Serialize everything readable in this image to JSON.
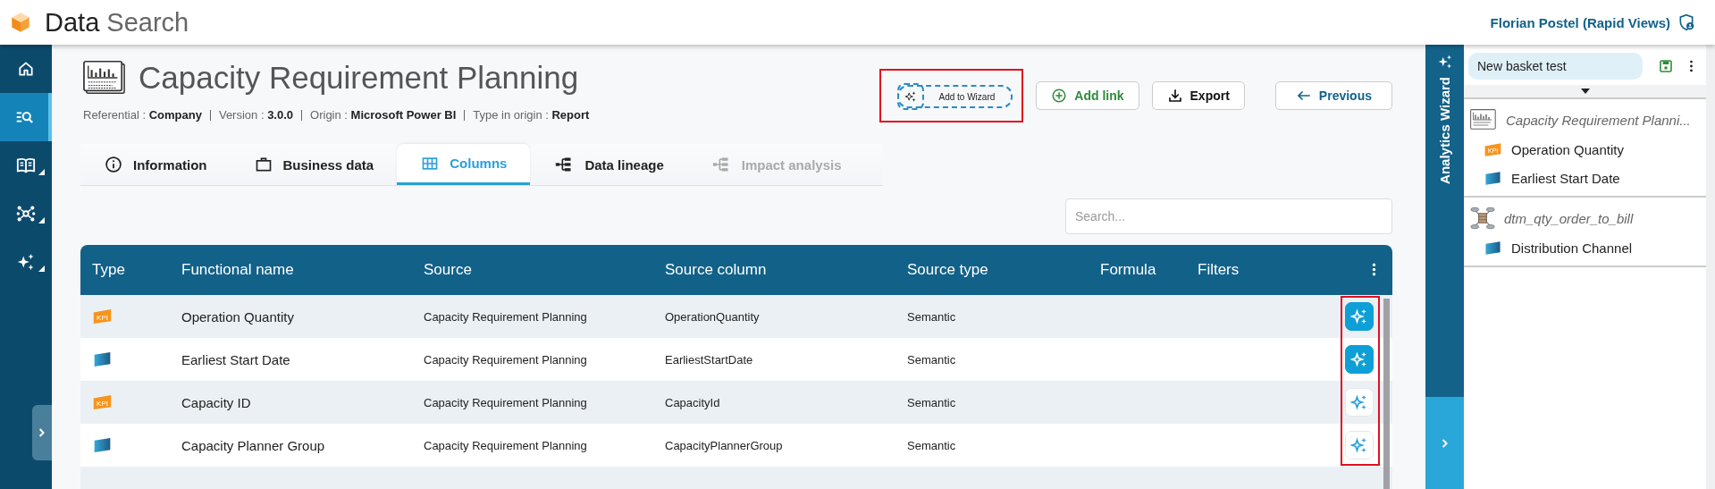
{
  "header": {
    "app_name_first": "Data",
    "app_name_second": "Search",
    "user": "Florian Postel (Rapid Views)"
  },
  "nav": {
    "items": [
      {
        "kind": "home",
        "selected": false,
        "submenu": false
      },
      {
        "kind": "search",
        "selected": true,
        "submenu": false
      },
      {
        "kind": "book",
        "selected": false,
        "submenu": true
      },
      {
        "kind": "network",
        "selected": false,
        "submenu": true
      },
      {
        "kind": "sparkle",
        "selected": false,
        "submenu": true
      }
    ]
  },
  "report": {
    "title": "Capacity Requirement Planning",
    "meta": [
      {
        "label": "Referential :",
        "value": "Company"
      },
      {
        "label": "Version :",
        "value": "3.0.0"
      },
      {
        "label": "Origin :",
        "value": "Microsoft Power BI"
      },
      {
        "label": "Type in origin :",
        "value": "Report"
      }
    ],
    "actions": [
      {
        "kind": "wizard",
        "label": "Add to Wizard",
        "highlighted": true
      },
      {
        "kind": "add",
        "label": "Add link",
        "highlighted": false
      },
      {
        "kind": "export",
        "label": "Export",
        "highlighted": false
      },
      {
        "kind": "previous",
        "label": "Previous",
        "highlighted": false
      }
    ]
  },
  "tabs": [
    {
      "kind": "info",
      "label": "Information",
      "selected": false,
      "disabled": false
    },
    {
      "kind": "briefcase",
      "label": "Business data",
      "selected": false,
      "disabled": false
    },
    {
      "kind": "grid",
      "label": "Columns",
      "selected": true,
      "disabled": false
    },
    {
      "kind": "lineage",
      "label": "Data lineage",
      "selected": false,
      "disabled": false
    },
    {
      "kind": "lineage",
      "label": "Impact analysis",
      "selected": false,
      "disabled": true
    }
  ],
  "search": {
    "placeholder": "Search..."
  },
  "table": {
    "columns": [
      "Type",
      "Functional name",
      "Source",
      "Source column",
      "Source type",
      "Formula",
      "Filters"
    ],
    "wizard_column_highlighted": true,
    "rows": [
      {
        "type": {
          "kind": "kpi",
          "label": "KPI"
        },
        "functional_name": "Operation Quantity",
        "source": "Capacity Requirement Planning",
        "source_column": "OperationQuantity",
        "source_type": "Semantic",
        "in_wizard": true
      },
      {
        "type": {
          "kind": "dimension"
        },
        "functional_name": "Earliest Start Date",
        "source": "Capacity Requirement Planning",
        "source_column": "EarliestStartDate",
        "source_type": "Semantic",
        "in_wizard": true
      },
      {
        "type": {
          "kind": "kpi",
          "label": "KPI"
        },
        "functional_name": "Capacity ID",
        "source": "Capacity Requirement Planning",
        "source_column": "CapacityId",
        "source_type": "Semantic",
        "in_wizard": false
      },
      {
        "type": {
          "kind": "dimension"
        },
        "functional_name": "Capacity Planner Group",
        "source": "Capacity Requirement Planning",
        "source_column": "CapacityPlannerGroup",
        "source_type": "Semantic",
        "in_wizard": false
      }
    ]
  },
  "wizard": {
    "title": "Analytics Wizard",
    "basket": {
      "value": "New basket test"
    },
    "groups": [
      {
        "kind": "report",
        "title": "Capacity Requirement Planni...",
        "items": [
          {
            "kind": "kpi",
            "badge": "KPI",
            "label": "Operation Quantity"
          },
          {
            "kind": "dimension",
            "label": "Earliest Start Date"
          }
        ]
      },
      {
        "kind": "datamart",
        "title": "dtm_qty_order_to_bill",
        "items": [
          {
            "kind": "dimension",
            "label": "Distribution Channel"
          }
        ]
      }
    ]
  }
}
